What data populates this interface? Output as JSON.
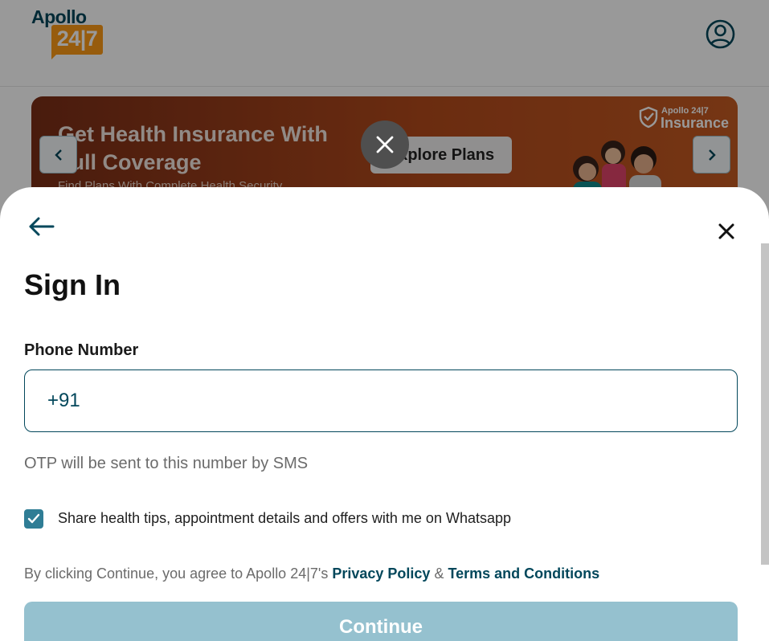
{
  "header": {
    "logo_word": "Apollo",
    "logo_num": "24|7",
    "profile_icon": "user-circle-icon"
  },
  "banner": {
    "title": "Get Health Insurance With Full Coverage",
    "subtitle": "Find Plans With Complete Health Security",
    "cta_label": "Explore Plans",
    "brand_small": "Apollo 24|7",
    "brand_word": "Insurance",
    "prev_icon": "chevron-left-icon",
    "next_icon": "chevron-right-icon"
  },
  "overlay": {
    "close_icon": "close-icon"
  },
  "sheet": {
    "back_icon": "arrow-left-icon",
    "close_icon": "close-icon",
    "title": "Sign In",
    "phone_label": "Phone Number",
    "phone_prefix": "+91",
    "phone_value": "",
    "helper_text": "OTP will be sent to this number by SMS",
    "whatsapp_checked": true,
    "whatsapp_label": "Share health tips, appointment details and offers with me on Whatsapp",
    "terms_prefix": "By clicking Continue, you agree to Apollo 24|7's ",
    "privacy_link": "Privacy Policy",
    "terms_amp": " & ",
    "terms_link": "Terms and Conditions",
    "continue_label": "Continue"
  },
  "colors": {
    "primary": "#02475b",
    "accent": "#fc9916",
    "checkbox": "#2f7d95",
    "button_disabled": "#95c1cf"
  }
}
